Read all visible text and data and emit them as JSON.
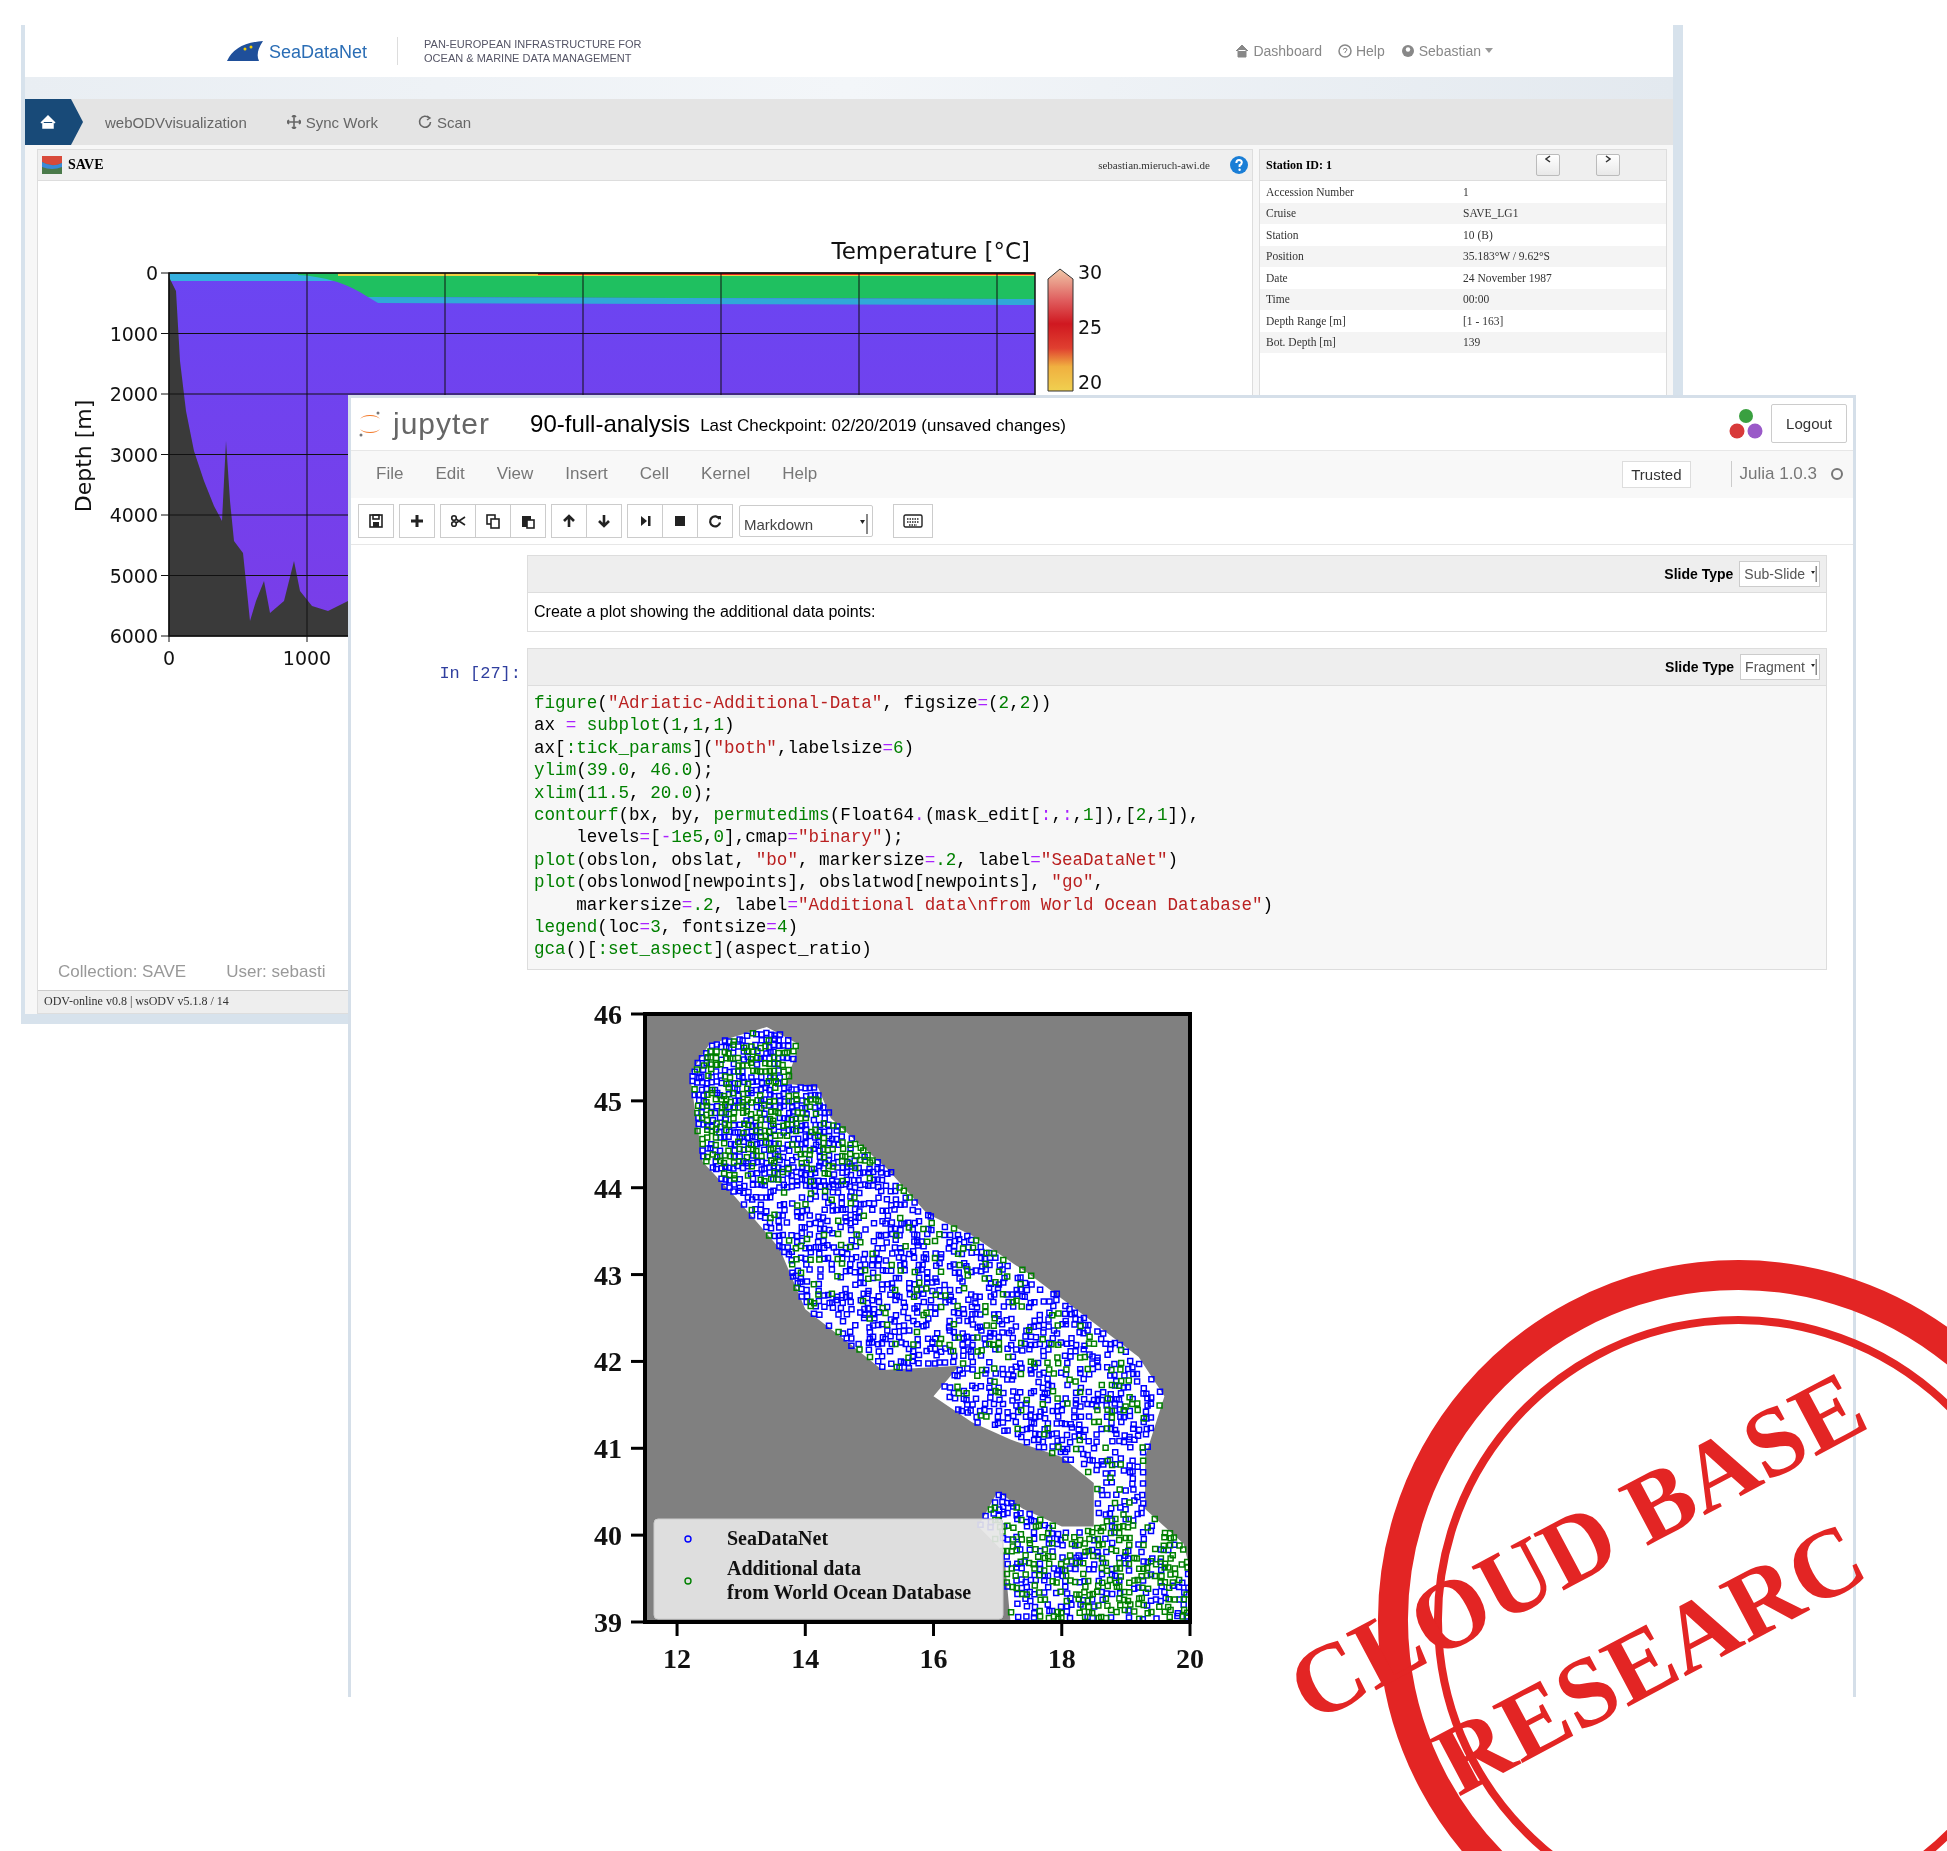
{
  "odv_window": {
    "header": {
      "logo_text": "SeaDataNet",
      "tagline": [
        "PAN-EUROPEAN INFRASTRUCTURE FOR",
        "OCEAN & MARINE DATA MANAGEMENT"
      ],
      "links": [
        {
          "label": "Dashboard",
          "kind": "dashboard"
        },
        {
          "label": "Help",
          "kind": "help"
        },
        {
          "label": "Sebastian",
          "kind": "user"
        }
      ]
    },
    "nav": [
      {
        "label": "webODVvisualization",
        "kind": "plain"
      },
      {
        "label": "Sync Work",
        "kind": "move"
      },
      {
        "label": "Scan",
        "kind": "refresh"
      }
    ],
    "panel": {
      "title": "SAVE",
      "server": "sebastian.mieruch-awi.de"
    },
    "section_plot": {
      "title": "Temperature [°C]",
      "ylabel": "Depth [m]",
      "yticks": [
        "0",
        "1000",
        "2000",
        "3000",
        "4000",
        "5000",
        "6000"
      ],
      "xticks": [
        "0",
        "1000"
      ],
      "colorbar_ticks": [
        "30",
        "25",
        "20"
      ]
    },
    "footer": {
      "collection": "Collection: SAVE",
      "user": "User: sebasti"
    },
    "status_bar": "ODV-online v0.8 | wsODV v5.1.8 / 14",
    "station": {
      "title": "Station ID: 1",
      "rows": [
        {
          "label": "Accession Number",
          "value": "1"
        },
        {
          "label": "Cruise",
          "value": "SAVE_LG1"
        },
        {
          "label": "Station",
          "value": "10 (B)"
        },
        {
          "label": "Position",
          "value": "35.183°W / 9.62°S"
        },
        {
          "label": "Date",
          "value": "24 November 1987"
        },
        {
          "label": "Time",
          "value": "00:00"
        },
        {
          "label": "Depth Range [m]",
          "value": "[1 - 163]"
        },
        {
          "label": "Bot. Depth [m]",
          "value": "139"
        }
      ]
    }
  },
  "jupyter": {
    "logo_text": "jupyter",
    "notebook_name": "90-full-analysis",
    "checkpoint": "Last Checkpoint: 02/20/2019 (unsaved changes)",
    "logout": "Logout",
    "menu": [
      "File",
      "Edit",
      "View",
      "Insert",
      "Cell",
      "Kernel",
      "Help"
    ],
    "trusted": "Trusted",
    "kernel": "Julia 1.0.3",
    "kernel_busy": false,
    "cell_type": "Markdown",
    "cells": [
      {
        "kind": "markdown",
        "slide_label": "Slide Type",
        "slide_type": "Sub-Slide",
        "text": "Create a plot showing the additional data points:"
      },
      {
        "kind": "code",
        "prompt": "In [27]:",
        "slide_label": "Slide Type",
        "slide_type": "Fragment",
        "lines": [
          [
            {
              "kind": "builtin",
              "text": "figure"
            },
            {
              "kind": "plain",
              "text": "("
            },
            {
              "kind": "string",
              "text": "\"Adriatic-Additional-Data\""
            },
            {
              "kind": "plain",
              "text": ", figsize"
            },
            {
              "kind": "operator",
              "text": "="
            },
            {
              "kind": "plain",
              "text": "("
            },
            {
              "kind": "number",
              "text": "2"
            },
            {
              "kind": "plain",
              "text": ","
            },
            {
              "kind": "number",
              "text": "2"
            },
            {
              "kind": "plain",
              "text": "))"
            }
          ],
          [
            {
              "kind": "plain",
              "text": "ax "
            },
            {
              "kind": "operator",
              "text": "="
            },
            {
              "kind": "builtin",
              "text": " subplot"
            },
            {
              "kind": "plain",
              "text": "("
            },
            {
              "kind": "number",
              "text": "1"
            },
            {
              "kind": "plain",
              "text": ","
            },
            {
              "kind": "number",
              "text": "1"
            },
            {
              "kind": "plain",
              "text": ","
            },
            {
              "kind": "number",
              "text": "1"
            },
            {
              "kind": "plain",
              "text": ")"
            }
          ],
          [
            {
              "kind": "plain",
              "text": "ax["
            },
            {
              "kind": "builtin",
              "text": ":tick_params"
            },
            {
              "kind": "plain",
              "text": "]("
            },
            {
              "kind": "string",
              "text": "\"both\""
            },
            {
              "kind": "plain",
              "text": ",labelsize"
            },
            {
              "kind": "operator",
              "text": "="
            },
            {
              "kind": "number",
              "text": "6"
            },
            {
              "kind": "plain",
              "text": ")"
            }
          ],
          [
            {
              "kind": "builtin",
              "text": "ylim"
            },
            {
              "kind": "plain",
              "text": "("
            },
            {
              "kind": "number",
              "text": "39.0"
            },
            {
              "kind": "plain",
              "text": ", "
            },
            {
              "kind": "number",
              "text": "46.0"
            },
            {
              "kind": "plain",
              "text": ");"
            }
          ],
          [
            {
              "kind": "builtin",
              "text": "xlim"
            },
            {
              "kind": "plain",
              "text": "("
            },
            {
              "kind": "number",
              "text": "11.5"
            },
            {
              "kind": "plain",
              "text": ", "
            },
            {
              "kind": "number",
              "text": "20.0"
            },
            {
              "kind": "plain",
              "text": ");"
            }
          ],
          [
            {
              "kind": "builtin",
              "text": "contourf"
            },
            {
              "kind": "plain",
              "text": "(bx, by, "
            },
            {
              "kind": "builtin",
              "text": "permutedims"
            },
            {
              "kind": "plain",
              "text": "(Float64"
            },
            {
              "kind": "operator",
              "text": "."
            },
            {
              "kind": "plain",
              "text": "(mask_edit["
            },
            {
              "kind": "operator",
              "text": ":"
            },
            {
              "kind": "plain",
              "text": ","
            },
            {
              "kind": "operator",
              "text": ":"
            },
            {
              "kind": "plain",
              "text": ","
            },
            {
              "kind": "number",
              "text": "1"
            },
            {
              "kind": "plain",
              "text": "]),["
            },
            {
              "kind": "number",
              "text": "2"
            },
            {
              "kind": "plain",
              "text": ","
            },
            {
              "kind": "number",
              "text": "1"
            },
            {
              "kind": "plain",
              "text": "]),"
            }
          ],
          [
            {
              "kind": "plain",
              "text": "    levels"
            },
            {
              "kind": "operator",
              "text": "="
            },
            {
              "kind": "plain",
              "text": "["
            },
            {
              "kind": "operator",
              "text": "-"
            },
            {
              "kind": "number",
              "text": "1e5"
            },
            {
              "kind": "plain",
              "text": ","
            },
            {
              "kind": "number",
              "text": "0"
            },
            {
              "kind": "plain",
              "text": "],cmap"
            },
            {
              "kind": "operator",
              "text": "="
            },
            {
              "kind": "string",
              "text": "\"binary\""
            },
            {
              "kind": "plain",
              "text": ");"
            }
          ],
          [
            {
              "kind": "builtin",
              "text": "plot"
            },
            {
              "kind": "plain",
              "text": "(obslon, obslat, "
            },
            {
              "kind": "string",
              "text": "\"bo\""
            },
            {
              "kind": "plain",
              "text": ", markersize"
            },
            {
              "kind": "operator",
              "text": "="
            },
            {
              "kind": "number",
              "text": ".2"
            },
            {
              "kind": "plain",
              "text": ", label"
            },
            {
              "kind": "operator",
              "text": "="
            },
            {
              "kind": "string",
              "text": "\"SeaDataNet\""
            },
            {
              "kind": "plain",
              "text": ")"
            }
          ],
          [
            {
              "kind": "builtin",
              "text": "plot"
            },
            {
              "kind": "plain",
              "text": "(obslonwod[newpoints], obslatwod[newpoints], "
            },
            {
              "kind": "string",
              "text": "\"go\""
            },
            {
              "kind": "plain",
              "text": ","
            }
          ],
          [
            {
              "kind": "plain",
              "text": "    markersize"
            },
            {
              "kind": "operator",
              "text": "="
            },
            {
              "kind": "number",
              "text": ".2"
            },
            {
              "kind": "plain",
              "text": ", label"
            },
            {
              "kind": "operator",
              "text": "="
            },
            {
              "kind": "string",
              "text": "\"Additional data\\nfrom World Ocean Database\""
            },
            {
              "kind": "plain",
              "text": ")"
            }
          ],
          [
            {
              "kind": "builtin",
              "text": "legend"
            },
            {
              "kind": "plain",
              "text": "(loc"
            },
            {
              "kind": "operator",
              "text": "="
            },
            {
              "kind": "number",
              "text": "3"
            },
            {
              "kind": "plain",
              "text": ", fontsize"
            },
            {
              "kind": "operator",
              "text": "="
            },
            {
              "kind": "number",
              "text": "4"
            },
            {
              "kind": "plain",
              "text": ")"
            }
          ],
          [
            {
              "kind": "builtin",
              "text": "gca"
            },
            {
              "kind": "plain",
              "text": "()["
            },
            {
              "kind": "builtin",
              "text": ":set_aspect"
            },
            {
              "kind": "plain",
              "text": "](aspect_ratio)"
            }
          ]
        ]
      }
    ],
    "output_plot": {
      "yticks": [
        "46",
        "45",
        "44",
        "43",
        "42",
        "41",
        "40",
        "39"
      ],
      "xticks": [
        "12",
        "14",
        "16",
        "18",
        "20"
      ],
      "legend": [
        {
          "lines": [
            "SeaDataNet"
          ],
          "color": "#0000ff"
        },
        {
          "lines": [
            "Additional data",
            "from World Ocean Database"
          ],
          "color": "#008000"
        }
      ]
    }
  },
  "stamp": {
    "lines": [
      "CLOUD BASE",
      "RESEARC"
    ]
  }
}
